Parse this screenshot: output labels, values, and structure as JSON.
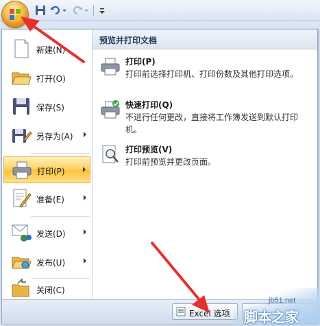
{
  "menu": {
    "items": [
      {
        "label": "新建(N)",
        "icon": "new-document-icon",
        "has_submenu": false
      },
      {
        "label": "打开(O)",
        "icon": "open-folder-icon",
        "has_submenu": false
      },
      {
        "label": "保存(S)",
        "icon": "save-disk-icon",
        "has_submenu": false
      },
      {
        "label": "另存为(A)",
        "icon": "save-as-icon",
        "has_submenu": true
      },
      {
        "label": "打印(P)",
        "icon": "printer-icon",
        "has_submenu": true,
        "active": true
      },
      {
        "label": "准备(E)",
        "icon": "prepare-icon",
        "has_submenu": true
      },
      {
        "label": "发送(D)",
        "icon": "send-icon",
        "has_submenu": true
      },
      {
        "label": "发布(U)",
        "icon": "publish-icon",
        "has_submenu": true
      },
      {
        "label": "关闭(C)",
        "icon": "close-folder-icon",
        "has_submenu": false
      }
    ]
  },
  "panel": {
    "title": "预览并打印文档",
    "options": [
      {
        "title": "打印(P)",
        "desc": "打印前选择打印机、打印份数及其他打印选项。",
        "icon": "printer-icon"
      },
      {
        "title": "快速打印(Q)",
        "desc": "不进行任何更改，直接将工作簿发送到默认打印机。",
        "icon": "quick-print-icon"
      },
      {
        "title": "打印预览(V)",
        "desc": "打印前预览并更改页面。",
        "icon": "print-preview-icon"
      }
    ]
  },
  "bottom": {
    "options_label": "Excel 选项"
  },
  "watermark": {
    "site": "jb51.net",
    "brand": "脚本之家"
  },
  "colors": {
    "active_item": "#ffd466",
    "annotation_arrow": "#e8302a",
    "panel_title": "#203a5c"
  }
}
